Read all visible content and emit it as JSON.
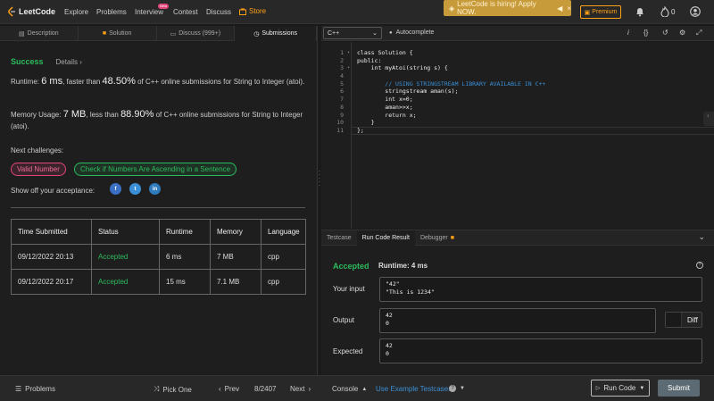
{
  "nav": {
    "brand": "LeetCode",
    "links": [
      "Explore",
      "Problems",
      "Interview",
      "Contest",
      "Discuss",
      "Store"
    ],
    "new_badge": "New",
    "hiring_banner": "LeetCode is hiring! Apply NOW.",
    "premium": "Premium",
    "streak": "0",
    "brand_color": "#ffa116"
  },
  "left_tabs": [
    "Description",
    "Solution",
    "Discuss (999+)",
    "Submissions"
  ],
  "result": {
    "status": "Success",
    "details": "Details",
    "runtime_prefix": "Runtime: ",
    "runtime_value": "6 ms",
    "runtime_mid": ", faster than ",
    "runtime_pct": "48.50%",
    "runtime_suffix": " of C++ online submissions for String to Integer (atoi).",
    "memory_prefix": "Memory Usage: ",
    "memory_value": "7 MB",
    "memory_mid": ", less than ",
    "memory_pct": "88.90%",
    "memory_suffix": " of C++ online submissions for String to Integer (atoi).",
    "next_label": "Next challenges:",
    "challenges": [
      "Valid Number",
      "Check if Numbers Are Ascending in a Sentence"
    ],
    "share_label": "Show off your acceptance:",
    "share_icons": [
      "facebook-icon",
      "twitter-icon",
      "linkedin-icon"
    ]
  },
  "submissions": {
    "headers": [
      "Time Submitted",
      "Status",
      "Runtime",
      "Memory",
      "Language"
    ],
    "rows": [
      [
        "09/12/2022 20:13",
        "Accepted",
        "6 ms",
        "7 MB",
        "cpp"
      ],
      [
        "09/12/2022 20:17",
        "Accepted",
        "15 ms",
        "7.1 MB",
        "cpp"
      ]
    ]
  },
  "editor": {
    "language": "C++",
    "autocomplete": "Autocomplete",
    "line_numbers": [
      "1",
      "2",
      "3",
      "4",
      "5",
      "6",
      "7",
      "8",
      "9",
      "10",
      "11"
    ],
    "lines": [
      "class Solution {",
      "public:",
      "    int myAtoi(string s) {",
      "",
      "        // USING STRINGSTREAM LIBRARY AVAILABLE IN C++",
      "        stringstream aman(s);",
      "        int x=0;",
      "        aman>>x;",
      "        return x;",
      "    }",
      "};"
    ]
  },
  "console": {
    "tabs": [
      "Testcase",
      "Run Code Result",
      "Debugger"
    ],
    "status": "Accepted",
    "runtime": "Runtime: 4 ms",
    "input_label": "Your input",
    "input_value": "\"42\"\n\"This is 1234\"",
    "output_label": "Output",
    "output_value": "42\n0",
    "expected_label": "Expected",
    "expected_value": "42\n0",
    "diff": "Diff"
  },
  "bottom": {
    "problems": "Problems",
    "pick_one": "Pick One",
    "prev": "Prev",
    "page": "8/2407",
    "next": "Next",
    "console": "Console",
    "example": "Use Example Testcases",
    "run_code": "Run Code",
    "submit": "Submit"
  }
}
